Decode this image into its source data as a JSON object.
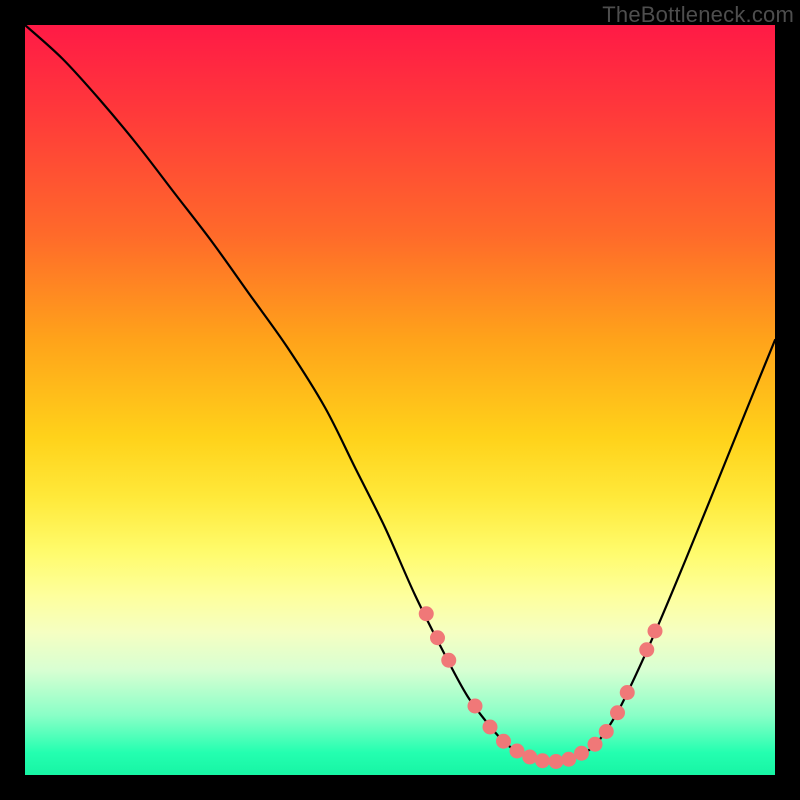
{
  "watermark": "TheBottleneck.com",
  "colors": {
    "frame": "#000000",
    "curve_stroke": "#000000",
    "dot_fill": "#f07878",
    "dot_stroke": "#c95a5a"
  },
  "chart_data": {
    "type": "line",
    "title": "",
    "xlabel": "",
    "ylabel": "",
    "xlim": [
      0,
      100
    ],
    "ylim": [
      0,
      100
    ],
    "grid": false,
    "legend": false,
    "series": [
      {
        "name": "bottleneck-curve",
        "x": [
          0,
          5,
          10,
          15,
          20,
          25,
          30,
          35,
          40,
          44,
          48,
          52,
          56,
          59,
          62,
          64,
          66,
          68,
          70,
          72,
          74,
          76,
          78,
          80,
          84,
          88,
          92,
          96,
          100
        ],
        "y": [
          100,
          95.5,
          90,
          84,
          77.5,
          71,
          64,
          57,
          49,
          41,
          33,
          24,
          16,
          10.5,
          6.5,
          4.3,
          2.9,
          2.1,
          1.8,
          1.9,
          2.6,
          4.0,
          6.7,
          10.3,
          19.0,
          28.5,
          38.3,
          48.2,
          58.0
        ]
      }
    ],
    "dots": [
      {
        "x": 53.5,
        "y": 21.5
      },
      {
        "x": 55.0,
        "y": 18.3
      },
      {
        "x": 56.5,
        "y": 15.3
      },
      {
        "x": 60.0,
        "y": 9.2
      },
      {
        "x": 62.0,
        "y": 6.4
      },
      {
        "x": 63.8,
        "y": 4.5
      },
      {
        "x": 65.6,
        "y": 3.2
      },
      {
        "x": 67.3,
        "y": 2.4
      },
      {
        "x": 69.0,
        "y": 1.9
      },
      {
        "x": 70.8,
        "y": 1.8
      },
      {
        "x": 72.5,
        "y": 2.1
      },
      {
        "x": 74.2,
        "y": 2.9
      },
      {
        "x": 76.0,
        "y": 4.1
      },
      {
        "x": 77.5,
        "y": 5.8
      },
      {
        "x": 79.0,
        "y": 8.3
      },
      {
        "x": 80.3,
        "y": 11.0
      },
      {
        "x": 82.9,
        "y": 16.7
      },
      {
        "x": 84.0,
        "y": 19.2
      }
    ]
  }
}
